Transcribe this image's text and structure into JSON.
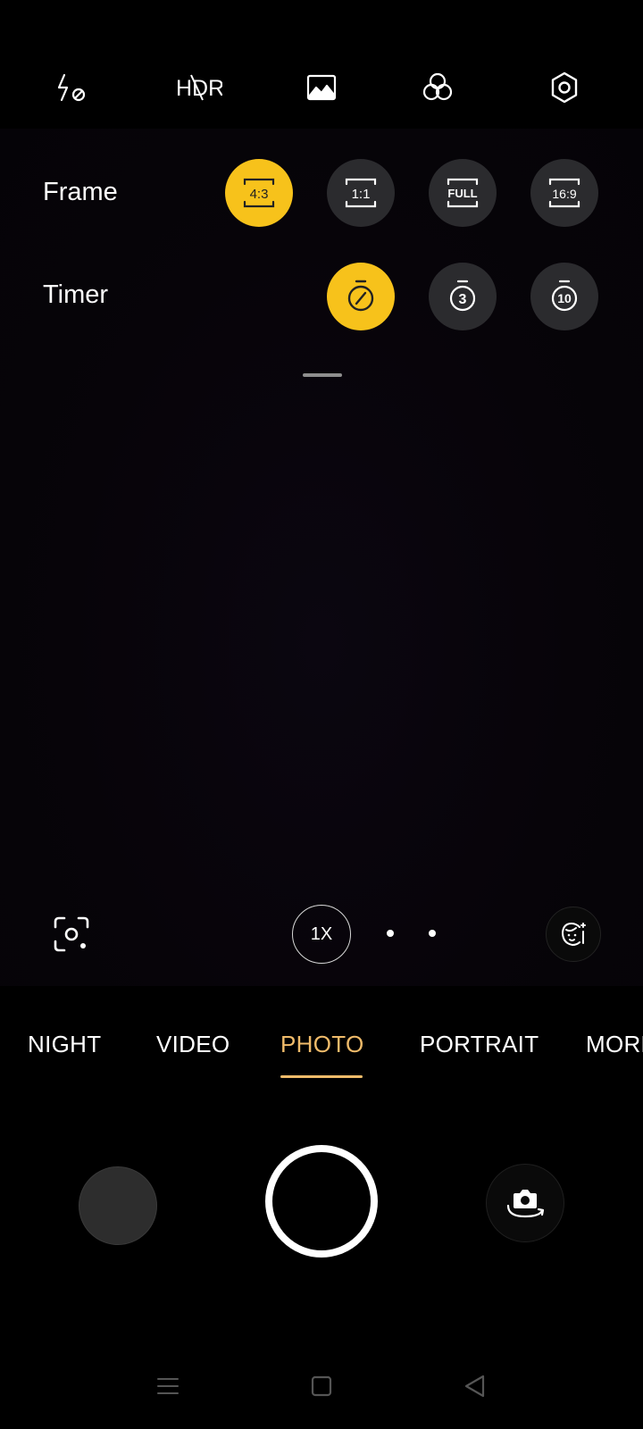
{
  "topbar": {
    "icons": [
      "flash-off-icon",
      "hdr-off-icon",
      "image-icon",
      "filter-icon",
      "settings-icon"
    ],
    "hdr_text": "HDR"
  },
  "settings_panel": {
    "frame": {
      "label": "Frame",
      "options": [
        "4:3",
        "1:1",
        "FULL",
        "16:9"
      ],
      "selected": "4:3"
    },
    "timer": {
      "label": "Timer",
      "options": [
        "off",
        "3",
        "10"
      ],
      "selected": "off"
    }
  },
  "zoom": {
    "label": "1X"
  },
  "modes": {
    "items": [
      "NIGHT",
      "VIDEO",
      "PHOTO",
      "PORTRAIT",
      "MORE"
    ],
    "active": "PHOTO"
  },
  "colors": {
    "selected_option": "#f7c21b",
    "active_mode": "#f0bb6a",
    "option_bg": "#2b2b2e"
  }
}
